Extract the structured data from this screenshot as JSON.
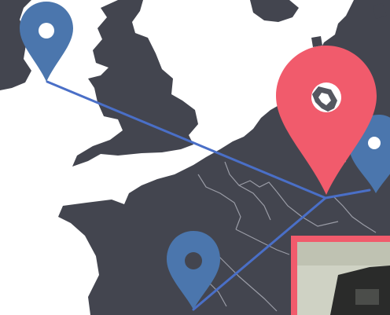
{
  "map": {
    "colors": {
      "sea": "#ffffff",
      "land": "#43454f",
      "border": "#9a9ca6",
      "route": "#4a6fc7",
      "pin_primary": "#f15b6c",
      "pin_secondary": "#4b76ad",
      "pin_hole": "#ffffff",
      "thumbnail_frame": "#f15b6c"
    },
    "pins": [
      {
        "role": "secondary",
        "icon": "map-pin-icon"
      },
      {
        "role": "primary",
        "icon": "map-pin-icon"
      },
      {
        "role": "secondary",
        "icon": "map-pin-icon"
      },
      {
        "role": "secondary",
        "icon": "map-pin-icon"
      }
    ],
    "routes_from_primary_hub": 3,
    "thumbnail": {
      "icon": "photo-thumbnail"
    }
  }
}
